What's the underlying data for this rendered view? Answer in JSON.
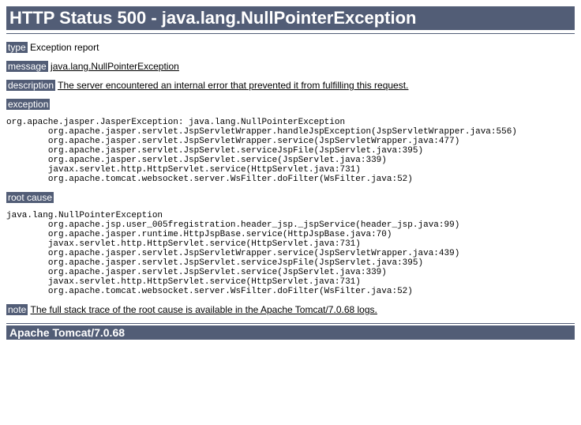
{
  "header": {
    "title": "HTTP Status 500 - java.lang.NullPointerException"
  },
  "type": {
    "label": "type",
    "value": "Exception report"
  },
  "message": {
    "label": "message",
    "value": "java.lang.NullPointerException"
  },
  "description": {
    "label": "description",
    "value": "The server encountered an internal error that prevented it from fulfilling this request."
  },
  "exception": {
    "label": "exception",
    "trace": "org.apache.jasper.JasperException: java.lang.NullPointerException\n\torg.apache.jasper.servlet.JspServletWrapper.handleJspException(JspServletWrapper.java:556)\n\torg.apache.jasper.servlet.JspServletWrapper.service(JspServletWrapper.java:477)\n\torg.apache.jasper.servlet.JspServlet.serviceJspFile(JspServlet.java:395)\n\torg.apache.jasper.servlet.JspServlet.service(JspServlet.java:339)\n\tjavax.servlet.http.HttpServlet.service(HttpServlet.java:731)\n\torg.apache.tomcat.websocket.server.WsFilter.doFilter(WsFilter.java:52)"
  },
  "rootcause": {
    "label": "root cause",
    "trace": "java.lang.NullPointerException\n\torg.apache.jsp.user_005fregistration.header_jsp._jspService(header_jsp.java:99)\n\torg.apache.jasper.runtime.HttpJspBase.service(HttpJspBase.java:70)\n\tjavax.servlet.http.HttpServlet.service(HttpServlet.java:731)\n\torg.apache.jasper.servlet.JspServletWrapper.service(JspServletWrapper.java:439)\n\torg.apache.jasper.servlet.JspServlet.serviceJspFile(JspServlet.java:395)\n\torg.apache.jasper.servlet.JspServlet.service(JspServlet.java:339)\n\tjavax.servlet.http.HttpServlet.service(HttpServlet.java:731)\n\torg.apache.tomcat.websocket.server.WsFilter.doFilter(WsFilter.java:52)"
  },
  "note": {
    "label": "note",
    "value": "The full stack trace of the root cause is available in the Apache Tomcat/7.0.68 logs."
  },
  "footer": {
    "server": "Apache Tomcat/7.0.68"
  }
}
